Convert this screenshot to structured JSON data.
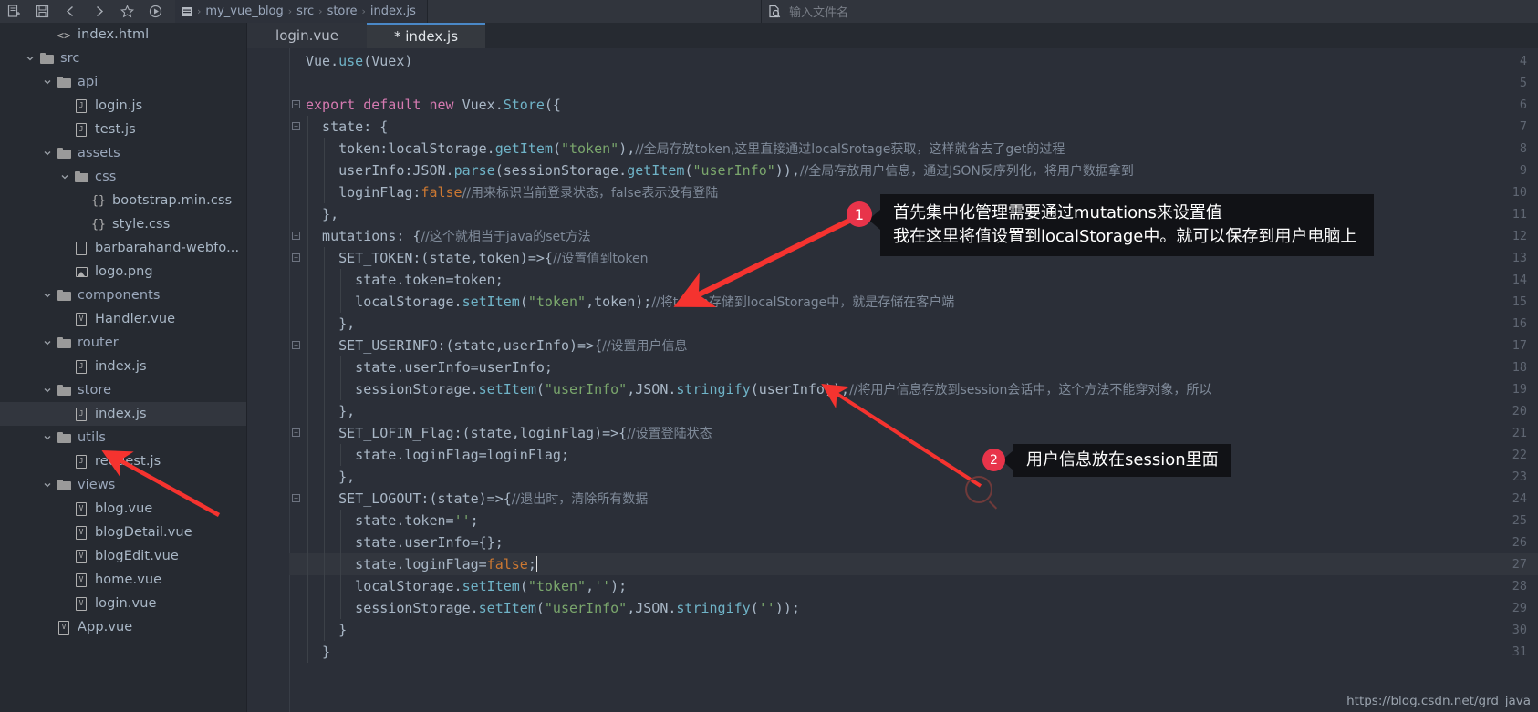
{
  "toolbar": {
    "icons": [
      {
        "name": "jump-to-source-icon",
        "glyph": "sheet-plus"
      },
      {
        "name": "save-all-icon",
        "glyph": "floppy"
      },
      {
        "name": "navigate-back-icon",
        "glyph": "chevron-left"
      },
      {
        "name": "navigate-forward-icon",
        "glyph": "chevron-right"
      },
      {
        "name": "bookmark-star-icon",
        "glyph": "star"
      },
      {
        "name": "run-icon",
        "glyph": "play-circle"
      }
    ],
    "breadcrumb": {
      "icon": "module-icon",
      "items": [
        "my_vue_blog",
        "src",
        "store",
        "index.js"
      ],
      "separator": "›"
    },
    "file_search": {
      "icon": "file-search-icon",
      "placeholder": "输入文件名"
    }
  },
  "project_tree": [
    {
      "label": "index.html",
      "indent": 2,
      "icon": "html-file-icon",
      "arrow": "none",
      "type": "file",
      "selected": false
    },
    {
      "label": "src",
      "indent": 1,
      "icon": "folder-icon",
      "arrow": "expanded",
      "type": "dir",
      "selected": false
    },
    {
      "label": "api",
      "indent": 2,
      "icon": "folder-icon",
      "arrow": "expanded",
      "type": "dir",
      "selected": false
    },
    {
      "label": "login.js",
      "indent": 3,
      "icon": "js-file-icon",
      "arrow": "none",
      "type": "file",
      "selected": false
    },
    {
      "label": "test.js",
      "indent": 3,
      "icon": "js-file-icon",
      "arrow": "none",
      "type": "file",
      "selected": false
    },
    {
      "label": "assets",
      "indent": 2,
      "icon": "folder-icon",
      "arrow": "expanded",
      "type": "dir",
      "selected": false
    },
    {
      "label": "css",
      "indent": 3,
      "icon": "folder-icon",
      "arrow": "expanded",
      "type": "dir",
      "selected": false
    },
    {
      "label": "bootstrap.min.css",
      "indent": 4,
      "icon": "css-file-icon",
      "arrow": "none",
      "type": "file",
      "selected": false
    },
    {
      "label": "style.css",
      "indent": 4,
      "icon": "css-file-icon",
      "arrow": "none",
      "type": "file",
      "selected": false
    },
    {
      "label": "barbarahand-webfo...",
      "indent": 3,
      "icon": "text-file-icon",
      "arrow": "none",
      "type": "file",
      "selected": false
    },
    {
      "label": "logo.png",
      "indent": 3,
      "icon": "image-file-icon",
      "arrow": "none",
      "type": "file",
      "selected": false
    },
    {
      "label": "components",
      "indent": 2,
      "icon": "folder-icon",
      "arrow": "expanded",
      "type": "dir",
      "selected": false
    },
    {
      "label": "Handler.vue",
      "indent": 3,
      "icon": "vue-file-icon",
      "arrow": "none",
      "type": "file",
      "selected": false
    },
    {
      "label": "router",
      "indent": 2,
      "icon": "folder-icon",
      "arrow": "expanded",
      "type": "dir",
      "selected": false
    },
    {
      "label": "index.js",
      "indent": 3,
      "icon": "js-file-icon",
      "arrow": "none",
      "type": "file",
      "selected": false
    },
    {
      "label": "store",
      "indent": 2,
      "icon": "folder-icon",
      "arrow": "expanded",
      "type": "dir",
      "selected": false
    },
    {
      "label": "index.js",
      "indent": 3,
      "icon": "js-file-icon",
      "arrow": "none",
      "type": "file",
      "selected": true
    },
    {
      "label": "utils",
      "indent": 2,
      "icon": "folder-icon",
      "arrow": "expanded",
      "type": "dir",
      "selected": false
    },
    {
      "label": "request.js",
      "indent": 3,
      "icon": "js-file-icon",
      "arrow": "none",
      "type": "file",
      "selected": false
    },
    {
      "label": "views",
      "indent": 2,
      "icon": "folder-icon",
      "arrow": "expanded",
      "type": "dir",
      "selected": false
    },
    {
      "label": "blog.vue",
      "indent": 3,
      "icon": "vue-file-icon",
      "arrow": "none",
      "type": "file",
      "selected": false
    },
    {
      "label": "blogDetail.vue",
      "indent": 3,
      "icon": "vue-file-icon",
      "arrow": "none",
      "type": "file",
      "selected": false
    },
    {
      "label": "blogEdit.vue",
      "indent": 3,
      "icon": "vue-file-icon",
      "arrow": "none",
      "type": "file",
      "selected": false
    },
    {
      "label": "home.vue",
      "indent": 3,
      "icon": "vue-file-icon",
      "arrow": "none",
      "type": "file",
      "selected": false
    },
    {
      "label": "login.vue",
      "indent": 3,
      "icon": "vue-file-icon",
      "arrow": "none",
      "type": "file",
      "selected": false
    },
    {
      "label": "App.vue",
      "indent": 2,
      "icon": "vue-file-icon",
      "arrow": "none",
      "type": "file",
      "selected": false
    }
  ],
  "editor": {
    "tabs": [
      {
        "label": "login.vue",
        "active": false,
        "modified": false
      },
      {
        "label": "* index.js",
        "active": true,
        "modified": true
      }
    ],
    "first_line_number": 4,
    "caret_line_number": 27,
    "lines": [
      {
        "n": 4,
        "fold": "none",
        "indent": 0,
        "tokens": [
          {
            "t": "Vue.",
            "c": "id"
          },
          {
            "t": "use",
            "c": "fn"
          },
          {
            "t": "(Vuex)",
            "c": "id"
          }
        ]
      },
      {
        "n": 5,
        "fold": "none",
        "indent": 0,
        "tokens": []
      },
      {
        "n": 6,
        "fold": "minus",
        "indent": 0,
        "tokens": [
          {
            "t": "export ",
            "c": "kw2"
          },
          {
            "t": "default ",
            "c": "kw2"
          },
          {
            "t": "new ",
            "c": "kw2"
          },
          {
            "t": "Vuex.",
            "c": "id"
          },
          {
            "t": "Store",
            "c": "fn"
          },
          {
            "t": "({",
            "c": "id"
          }
        ]
      },
      {
        "n": 7,
        "fold": "minus",
        "indent": 1,
        "tokens": [
          {
            "t": "  state: {",
            "c": "id"
          }
        ]
      },
      {
        "n": 8,
        "fold": "none",
        "indent": 2,
        "tokens": [
          {
            "t": "    token:localStorage.",
            "c": "id"
          },
          {
            "t": "getItem",
            "c": "fn"
          },
          {
            "t": "(",
            "c": "id"
          },
          {
            "t": "\"token\"",
            "c": "str"
          },
          {
            "t": "),",
            "c": "id"
          },
          {
            "t": "//全局存放token,这里直接通过localSrotage获取，这样就省去了get的过程",
            "c": "cmt"
          }
        ]
      },
      {
        "n": 9,
        "fold": "none",
        "indent": 2,
        "tokens": [
          {
            "t": "    userInfo:JSON.",
            "c": "id"
          },
          {
            "t": "parse",
            "c": "fn"
          },
          {
            "t": "(sessionStorage.",
            "c": "id"
          },
          {
            "t": "getItem",
            "c": "fn"
          },
          {
            "t": "(",
            "c": "id"
          },
          {
            "t": "\"userInfo\"",
            "c": "str"
          },
          {
            "t": ")),",
            "c": "id"
          },
          {
            "t": "//全局存放用户信息，通过JSON反序列化，将用户数据拿到",
            "c": "cmt"
          }
        ]
      },
      {
        "n": 10,
        "fold": "none",
        "indent": 2,
        "tokens": [
          {
            "t": "    loginFlag:",
            "c": "id"
          },
          {
            "t": "false",
            "c": "kw"
          },
          {
            "t": "//用来标识当前登录状态，false表示没有登陆",
            "c": "cmt"
          }
        ]
      },
      {
        "n": 11,
        "fold": "bar",
        "indent": 1,
        "tokens": [
          {
            "t": "  },",
            "c": "id"
          }
        ]
      },
      {
        "n": 12,
        "fold": "minus",
        "indent": 1,
        "tokens": [
          {
            "t": "  mutations: {",
            "c": "id"
          },
          {
            "t": "//这个就相当于java的set方法",
            "c": "cmt"
          }
        ]
      },
      {
        "n": 13,
        "fold": "minus",
        "indent": 2,
        "tokens": [
          {
            "t": "    SET_TOKEN:(state,token)=>{",
            "c": "id"
          },
          {
            "t": "//设置值到token",
            "c": "cmt"
          }
        ]
      },
      {
        "n": 14,
        "fold": "none",
        "indent": 3,
        "tokens": [
          {
            "t": "      state.token=token;",
            "c": "id"
          }
        ]
      },
      {
        "n": 15,
        "fold": "none",
        "indent": 3,
        "tokens": [
          {
            "t": "      localStorage.",
            "c": "id"
          },
          {
            "t": "setItem",
            "c": "fn"
          },
          {
            "t": "(",
            "c": "id"
          },
          {
            "t": "\"token\"",
            "c": "str"
          },
          {
            "t": ",token);",
            "c": "id"
          },
          {
            "t": "//将token存储到localStorage中，就是存储在客户端",
            "c": "cmt"
          }
        ]
      },
      {
        "n": 16,
        "fold": "bar",
        "indent": 2,
        "tokens": [
          {
            "t": "    },",
            "c": "id"
          }
        ]
      },
      {
        "n": 17,
        "fold": "minus",
        "indent": 2,
        "tokens": [
          {
            "t": "    SET_USERINFO:(state,userInfo)=>{",
            "c": "id"
          },
          {
            "t": "//设置用户信息",
            "c": "cmt"
          }
        ]
      },
      {
        "n": 18,
        "fold": "none",
        "indent": 3,
        "tokens": [
          {
            "t": "      state.userInfo=userInfo;",
            "c": "id"
          }
        ]
      },
      {
        "n": 19,
        "fold": "none",
        "indent": 3,
        "tokens": [
          {
            "t": "      sessionStorage.",
            "c": "id"
          },
          {
            "t": "setItem",
            "c": "fn"
          },
          {
            "t": "(",
            "c": "id"
          },
          {
            "t": "\"userInfo\"",
            "c": "str"
          },
          {
            "t": ",JSON.",
            "c": "id"
          },
          {
            "t": "stringify",
            "c": "fn"
          },
          {
            "t": "(userInfo));",
            "c": "id"
          },
          {
            "t": "//将用户信息存放到session会话中，这个方法不能穿对象，所以",
            "c": "cmt"
          }
        ]
      },
      {
        "n": 20,
        "fold": "bar",
        "indent": 2,
        "tokens": [
          {
            "t": "    },",
            "c": "id"
          }
        ]
      },
      {
        "n": 21,
        "fold": "minus",
        "indent": 2,
        "tokens": [
          {
            "t": "    SET_LOFIN_Flag:(state,loginFlag)=>{",
            "c": "id"
          },
          {
            "t": "//设置登陆状态",
            "c": "cmt"
          }
        ]
      },
      {
        "n": 22,
        "fold": "none",
        "indent": 3,
        "tokens": [
          {
            "t": "      state.loginFlag=loginFlag;",
            "c": "id"
          }
        ]
      },
      {
        "n": 23,
        "fold": "bar",
        "indent": 2,
        "tokens": [
          {
            "t": "    },",
            "c": "id"
          }
        ]
      },
      {
        "n": 24,
        "fold": "minus",
        "indent": 2,
        "tokens": [
          {
            "t": "    SET_LOGOUT:(state)=>{",
            "c": "id"
          },
          {
            "t": "//退出时，清除所有数据",
            "c": "cmt"
          }
        ]
      },
      {
        "n": 25,
        "fold": "none",
        "indent": 3,
        "tokens": [
          {
            "t": "      state.token=",
            "c": "id"
          },
          {
            "t": "''",
            "c": "str"
          },
          {
            "t": ";",
            "c": "id"
          }
        ]
      },
      {
        "n": 26,
        "fold": "none",
        "indent": 3,
        "tokens": [
          {
            "t": "      state.userInfo={};",
            "c": "id"
          }
        ]
      },
      {
        "n": 27,
        "fold": "none",
        "indent": 3,
        "tokens": [
          {
            "t": "      state.loginFlag=",
            "c": "id"
          },
          {
            "t": "false",
            "c": "kw"
          },
          {
            "t": ";",
            "c": "id"
          }
        ]
      },
      {
        "n": 28,
        "fold": "none",
        "indent": 3,
        "tokens": [
          {
            "t": "      localStorage.",
            "c": "id"
          },
          {
            "t": "setItem",
            "c": "fn"
          },
          {
            "t": "(",
            "c": "id"
          },
          {
            "t": "\"token\"",
            "c": "str"
          },
          {
            "t": ",",
            "c": "id"
          },
          {
            "t": "''",
            "c": "str"
          },
          {
            "t": ");",
            "c": "id"
          }
        ]
      },
      {
        "n": 29,
        "fold": "none",
        "indent": 3,
        "tokens": [
          {
            "t": "      sessionStorage.",
            "c": "id"
          },
          {
            "t": "setItem",
            "c": "fn"
          },
          {
            "t": "(",
            "c": "id"
          },
          {
            "t": "\"userInfo\"",
            "c": "str"
          },
          {
            "t": ",JSON.",
            "c": "id"
          },
          {
            "t": "stringify",
            "c": "fn"
          },
          {
            "t": "(",
            "c": "id"
          },
          {
            "t": "''",
            "c": "str"
          },
          {
            "t": "));",
            "c": "id"
          }
        ]
      },
      {
        "n": 30,
        "fold": "bar",
        "indent": 2,
        "tokens": [
          {
            "t": "    }",
            "c": "id"
          }
        ]
      },
      {
        "n": 31,
        "fold": "bar",
        "indent": 1,
        "tokens": [
          {
            "t": "  }",
            "c": "id"
          }
        ]
      }
    ]
  },
  "annotations": [
    {
      "number": "1",
      "text": "首先集中化管理需要通过mutations来设置值\n我在这里将值设置到localStorage中。就可以保存到用户电脑上"
    },
    {
      "number": "2",
      "text": "用户信息放在session里面"
    }
  ],
  "watermark": "https://blog.csdn.net/grd_java",
  "colors": {
    "accent_red": "#e8344a",
    "arrow_red": "#f5332f",
    "editor_bg": "#2b2f38",
    "sidebar_bg": "#262a31",
    "tab_active": "#35393f",
    "tooltip_bg": "#111216"
  }
}
